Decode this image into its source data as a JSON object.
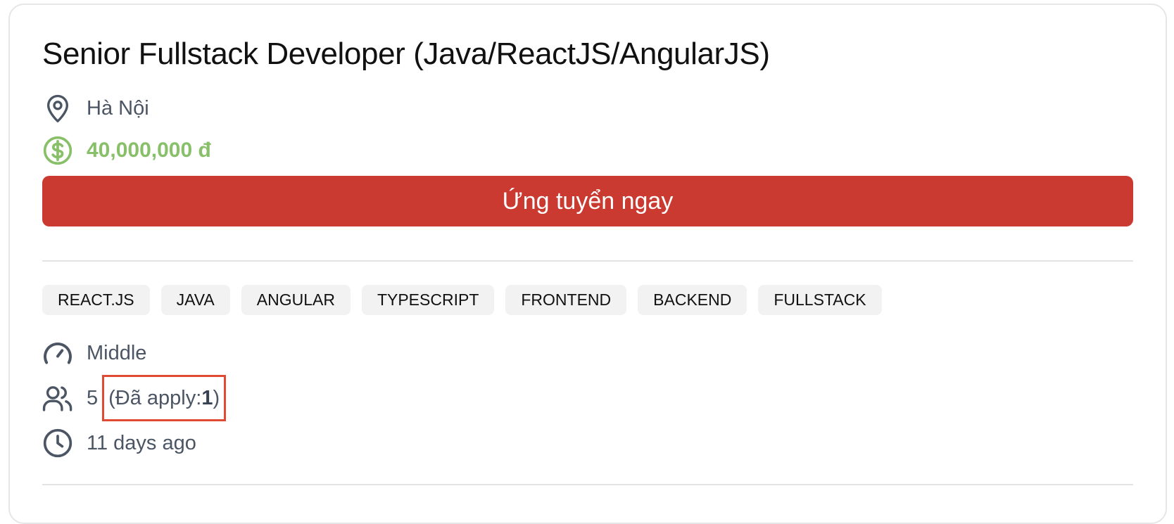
{
  "job": {
    "title": "Senior Fullstack Developer (Java/ReactJS/AngularJS)",
    "location": "Hà Nội",
    "salary": "40,000,000 đ",
    "apply_label": "Ứng tuyển ngay",
    "tags": [
      "REACT.JS",
      "JAVA",
      "ANGULAR",
      "TYPESCRIPT",
      "FRONTEND",
      "BACKEND",
      "FULLSTACK"
    ],
    "level": "Middle",
    "openings": "5",
    "applied_prefix": "(Đã apply: ",
    "applied_count": "1",
    "applied_suffix": ")",
    "posted": "11 days ago"
  },
  "icons": {
    "location": "map-pin-icon",
    "salary": "dollar-circle-icon",
    "level": "gauge-icon",
    "openings": "users-icon",
    "posted": "clock-icon"
  },
  "colors": {
    "accent": "#cb3a31",
    "salary": "#88bf69",
    "highlight_border": "#e04a33",
    "icon": "#4b5563"
  }
}
